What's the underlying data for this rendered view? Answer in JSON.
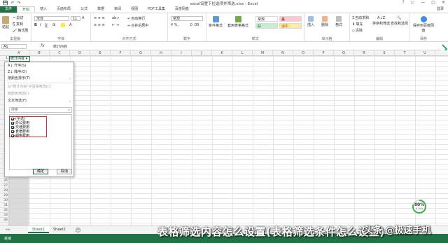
{
  "window": {
    "title": "excel设置下拉选项并筛选.xlsx - Excel",
    "login": "登录"
  },
  "qat": [
    "💾",
    "↶",
    "↷"
  ],
  "tabs": [
    {
      "label": "文件",
      "kind": "file"
    },
    {
      "label": "开始",
      "kind": "active"
    },
    {
      "label": "插入",
      "kind": ""
    },
    {
      "label": "页面布局",
      "kind": ""
    },
    {
      "label": "公式",
      "kind": ""
    },
    {
      "label": "数据",
      "kind": ""
    },
    {
      "label": "审阅",
      "kind": ""
    },
    {
      "label": "视图",
      "kind": ""
    },
    {
      "label": "PDF工具集",
      "kind": ""
    },
    {
      "label": "百度网盘",
      "kind": ""
    }
  ],
  "ribbon": {
    "clipboard": {
      "label": "剪贴板",
      "paste": "粘贴",
      "cut": "剪切",
      "copy": "复制",
      "painter": "格式刷"
    },
    "font": {
      "label": "字体",
      "name": "宋体",
      "size": "11"
    },
    "alignment": {
      "label": "对齐方式",
      "wrap": "自动换行",
      "merge": "合并后居中"
    },
    "number": {
      "label": "数字",
      "format": "常规"
    },
    "styles": {
      "label": "样式",
      "conditional": "条件格式",
      "table": "套用表格格式",
      "normal": "常规",
      "bad": "差",
      "good": "好",
      "neutral": "适中"
    },
    "cells": {
      "label": "单元格",
      "insert": "插入",
      "delete": "删除",
      "format": "格式"
    },
    "editing": {
      "label": "编辑",
      "autosum": "自动求和",
      "fill": "填充",
      "clear": "清除",
      "sort": "排序和筛选",
      "find": "查找和选择"
    },
    "save": {
      "label": "保存",
      "baidu": "保存到百度网盘"
    }
  },
  "formula": {
    "cell": "A1",
    "fx": "fx",
    "content": "统计内容"
  },
  "columns": [
    "A",
    "B",
    "C",
    "D",
    "E",
    "F",
    "G",
    "H",
    "I",
    "J",
    "K",
    "L",
    "M",
    "N",
    "O",
    "P",
    "Q",
    "R",
    "S",
    "T",
    "U"
  ],
  "rows": [
    "1",
    "2",
    "3",
    "4",
    "5",
    "6",
    "7",
    "8",
    "9",
    "10",
    "11",
    "12",
    "13",
    "14",
    "15",
    "16",
    "17",
    "18",
    "19",
    "20",
    "21",
    "22",
    "23",
    "24",
    "25",
    "26",
    "27",
    "28",
    "29",
    "30",
    "31",
    "32",
    "33",
    "34"
  ],
  "a1_value": "统计内容",
  "dropdown": {
    "sort_asc": "升序(S)",
    "sort_desc": "降序(O)",
    "sort_color": "按颜色排序(T)",
    "clear_filter": "从\"统计内容\"中清除筛选(C)",
    "filter_color": "按颜色筛选(I)",
    "text_filter": "文本筛选(F)",
    "search_placeholder": "搜索",
    "items": [
      "(全选)",
      "办公费用",
      "交通费用",
      "食宿费用",
      "邮电费用"
    ],
    "ok": "确定",
    "cancel": "取消"
  },
  "sheets": [
    {
      "label": "Sheet1",
      "active": true
    },
    {
      "label": "Sheet2",
      "active": false
    }
  ],
  "status": {
    "ready": "就绪"
  },
  "overlay": "表格筛选内容怎么设置(表格筛选条件怎么设置)",
  "watermark": "头条 @极速手机",
  "gauge": {
    "percent": "80%",
    "sub": "0.1k/s"
  }
}
